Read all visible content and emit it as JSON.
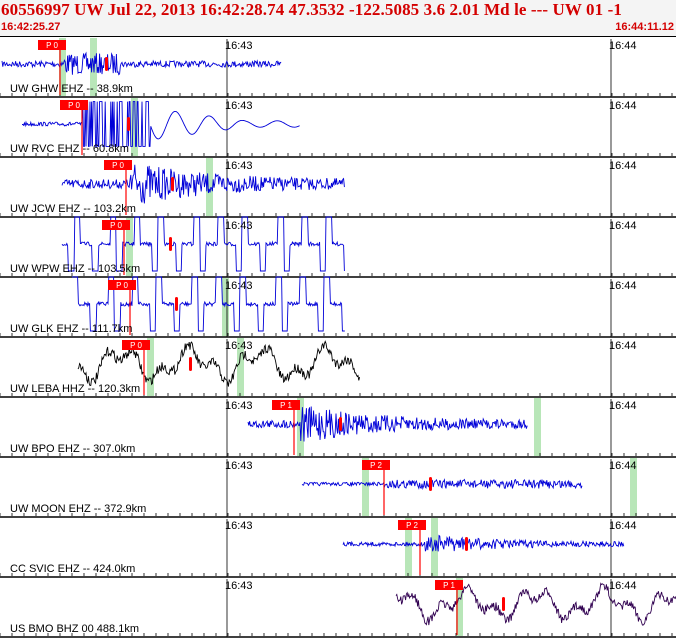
{
  "header": {
    "title": "60556997 UW Jul 22, 2013 16:42:28.74   47.3532 -122.5085  3.6 2.01 Md le --- UW 01  -1",
    "start_time": "16:42:25.27",
    "end_time": "16:44:11.12"
  },
  "time_ticks": [
    "16:43",
    "16:44"
  ],
  "colors": {
    "title": "#d40000",
    "trace_blue": "#0000d8",
    "trace_black": "#000000",
    "trace_purple": "#300050",
    "pick_box": "#ff0000",
    "window_band": "#b8e6b8",
    "axis": "#000000"
  },
  "traces": [
    {
      "label": "UW GHW EHZ -- 38.9km",
      "pick": "P 0",
      "color": "blue"
    },
    {
      "label": "UW RVC EHZ -- 60.8km",
      "pick": "P 0",
      "color": "blue"
    },
    {
      "label": "UW JCW EHZ -- 103.2km",
      "pick": "P 0",
      "color": "blue"
    },
    {
      "label": "UW WPW EHZ -- 103.5km",
      "pick": "P 0",
      "color": "blue"
    },
    {
      "label": "UW GLK EHZ -- 111.7km",
      "pick": "P 0",
      "color": "blue"
    },
    {
      "label": "UW LEBA HHZ -- 120.3km",
      "pick": "P 0",
      "color": "black"
    },
    {
      "label": "UW BPO EHZ -- 307.0km",
      "pick": "P 1",
      "color": "blue"
    },
    {
      "label": "UW MOON EHZ -- 372.9km",
      "pick": "P 2",
      "color": "blue"
    },
    {
      "label": "CC SVIC EHZ -- 424.0km",
      "pick": "P 2",
      "color": "blue"
    },
    {
      "label": "US BMO BHZ 00 488.1km",
      "pick": "P 1",
      "color": "purple"
    }
  ]
}
